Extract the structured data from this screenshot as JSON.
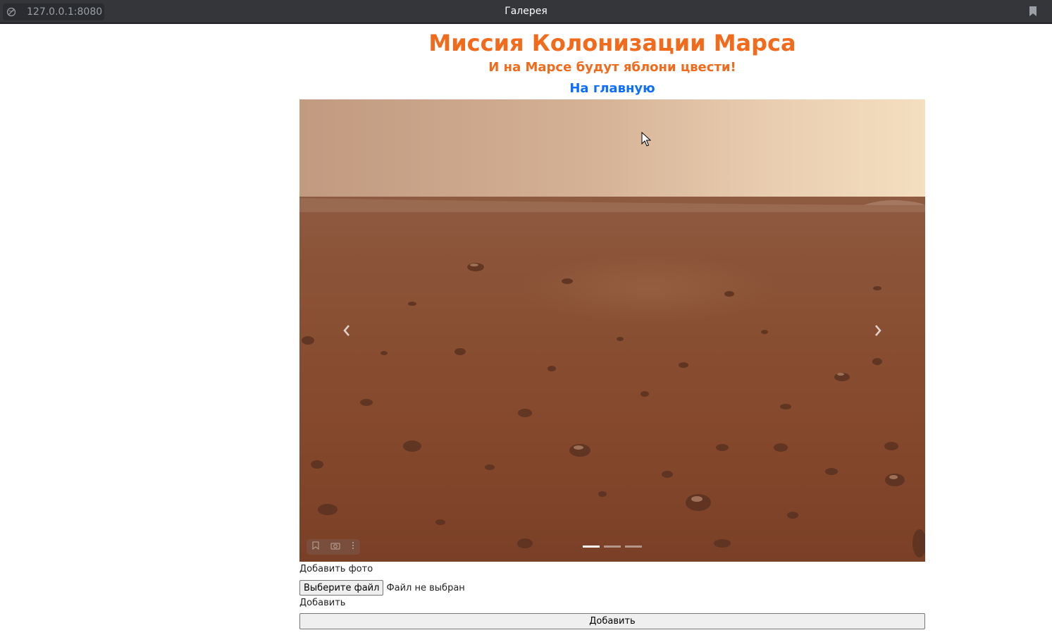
{
  "browser": {
    "url": "127.0.0.1:8080",
    "tab_title": "Галерея"
  },
  "header": {
    "title": "Миссия Колонизации Марса",
    "subtitle": "И на Марсе будут яблони цвести!",
    "home_link": "На главную"
  },
  "carousel": {
    "slides_count": 3,
    "active_index": 0
  },
  "form": {
    "photo_label": "Добавить фото",
    "file_button": "Выберите файл",
    "file_status": "Файл не выбран",
    "add_label": "Добавить",
    "submit_button": "Добавить"
  },
  "colors": {
    "accent": "#f26a1b",
    "link": "#0d6efd"
  }
}
